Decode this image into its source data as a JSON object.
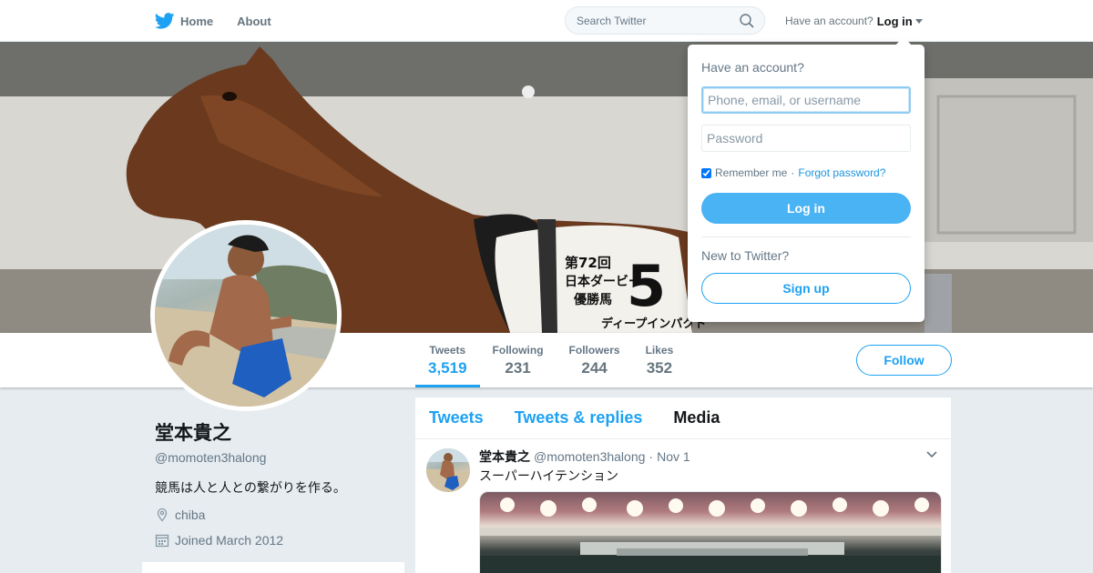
{
  "nav": {
    "home_label": "Home",
    "about_label": "About",
    "search_placeholder": "Search Twitter",
    "account_prompt": "Have an account?",
    "login_label": "Log in"
  },
  "profile_nav": {
    "stats": [
      {
        "label": "Tweets",
        "value": "3,519"
      },
      {
        "label": "Following",
        "value": "231"
      },
      {
        "label": "Followers",
        "value": "244"
      },
      {
        "label": "Likes",
        "value": "352"
      }
    ],
    "follow_label": "Follow"
  },
  "profile": {
    "name": "堂本貴之",
    "handle": "@momoten3halong",
    "bio": "競馬は人と人との繋がりを作る。",
    "location": "chiba",
    "joined": "Joined March 2012"
  },
  "banner": {
    "saddle_line1": "第72回",
    "saddle_line2": "日本ダービー",
    "saddle_line3": "優勝馬",
    "saddle_number": "5",
    "saddle_bottom": "ディープインパクト"
  },
  "timeline": {
    "tabs": [
      "Tweets",
      "Tweets & replies",
      "Media"
    ],
    "tweet": {
      "name": "堂本貴之",
      "handle": "@momoten3halong",
      "sep": "·",
      "date": "Nov 1",
      "text": "スーパーハイテンション"
    }
  },
  "login_dropdown": {
    "title": "Have an account?",
    "username_placeholder": "Phone, email, or username",
    "password_placeholder": "Password",
    "remember_label": "Remember me",
    "remember_sep": "·",
    "forgot_label": "Forgot password?",
    "login_button": "Log in",
    "new_prompt": "New to Twitter?",
    "signup_button": "Sign up"
  },
  "colors": {
    "accent": "#1da1f2",
    "login_button": "#4ab3f4",
    "background": "#e6ecf0",
    "secondary_text": "#657786"
  },
  "icons": [
    "twitter-bird-icon",
    "search-icon",
    "caret-down-icon",
    "location-pin-icon",
    "calendar-icon",
    "chevron-down-icon"
  ]
}
